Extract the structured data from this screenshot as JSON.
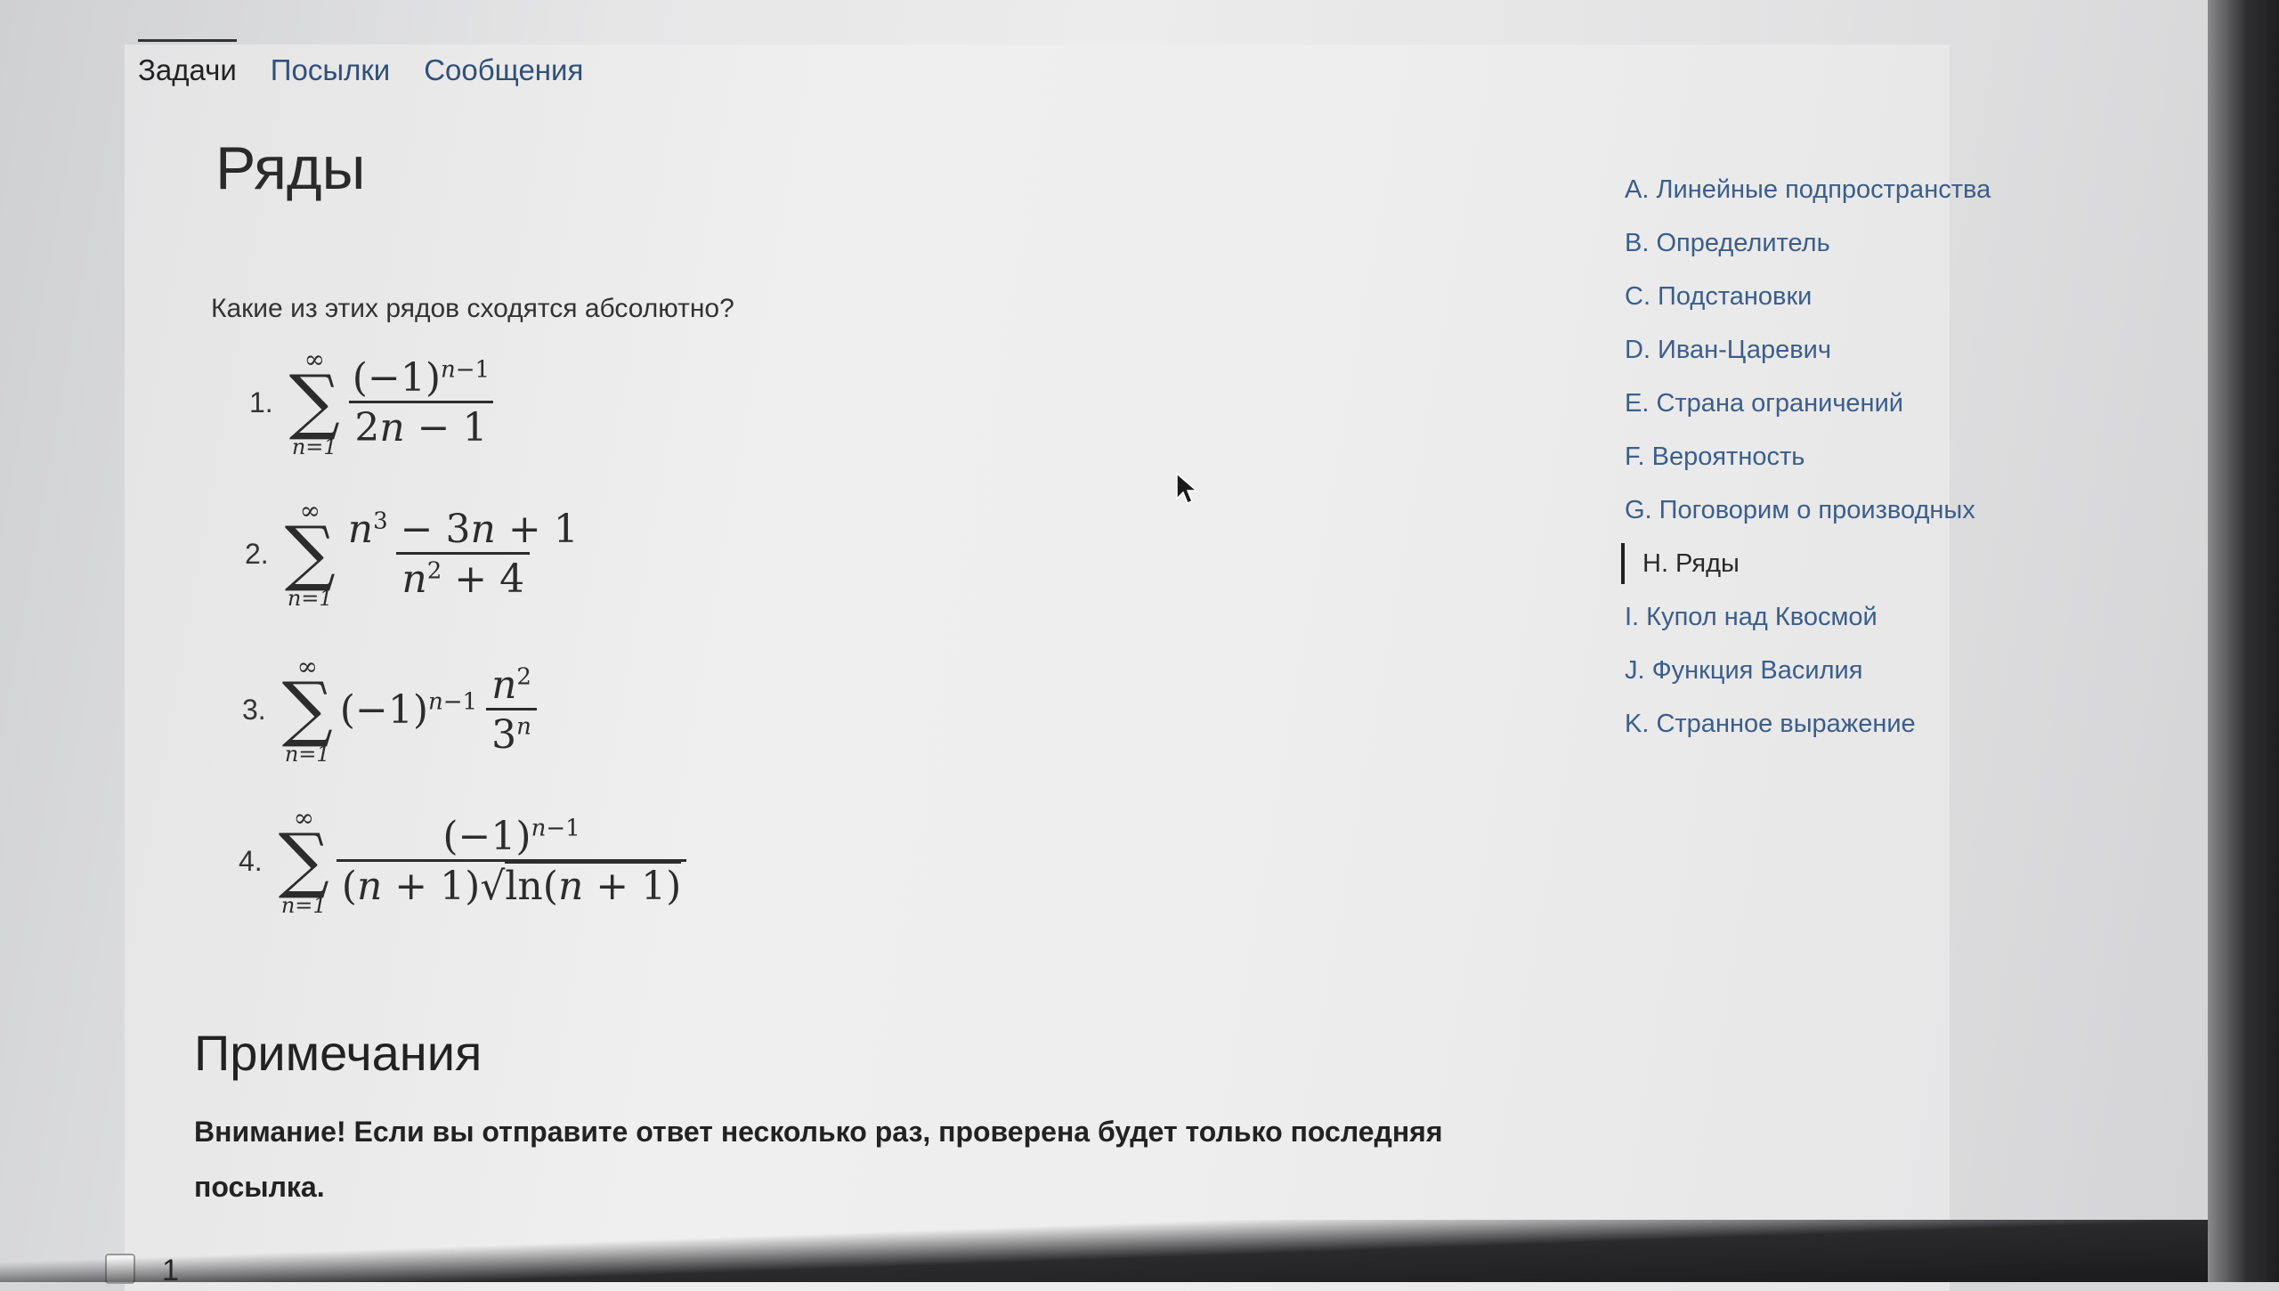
{
  "nav": {
    "tabs": [
      {
        "label": "Задачи"
      },
      {
        "label": "Посылки"
      },
      {
        "label": "Сообщения"
      }
    ]
  },
  "page_title": "Ряды",
  "question": "Какие из этих рядов сходятся абсолютно?",
  "series_items": [
    {
      "number": "1."
    },
    {
      "number": "2."
    },
    {
      "number": "3."
    },
    {
      "number": "4."
    }
  ],
  "notes": {
    "title": "Примечания",
    "text": "Внимание! Если вы отправите ответ несколько раз, проверена будет только последняя посылка."
  },
  "sidebar": {
    "items": [
      {
        "label": "A. Линейные подпространства"
      },
      {
        "label": "B. Определитель"
      },
      {
        "label": "C. Подстановки"
      },
      {
        "label": "D. Иван-Царевич"
      },
      {
        "label": "E. Страна ограничений"
      },
      {
        "label": "F. Вероятность"
      },
      {
        "label": "G. Поговорим о производных"
      },
      {
        "label": "H. Ряды"
      },
      {
        "label": "I. Купол над Квосмой"
      },
      {
        "label": "J. Функция Василия"
      },
      {
        "label": "K. Странное выражение"
      }
    ]
  },
  "answer_option": {
    "label": "1"
  }
}
